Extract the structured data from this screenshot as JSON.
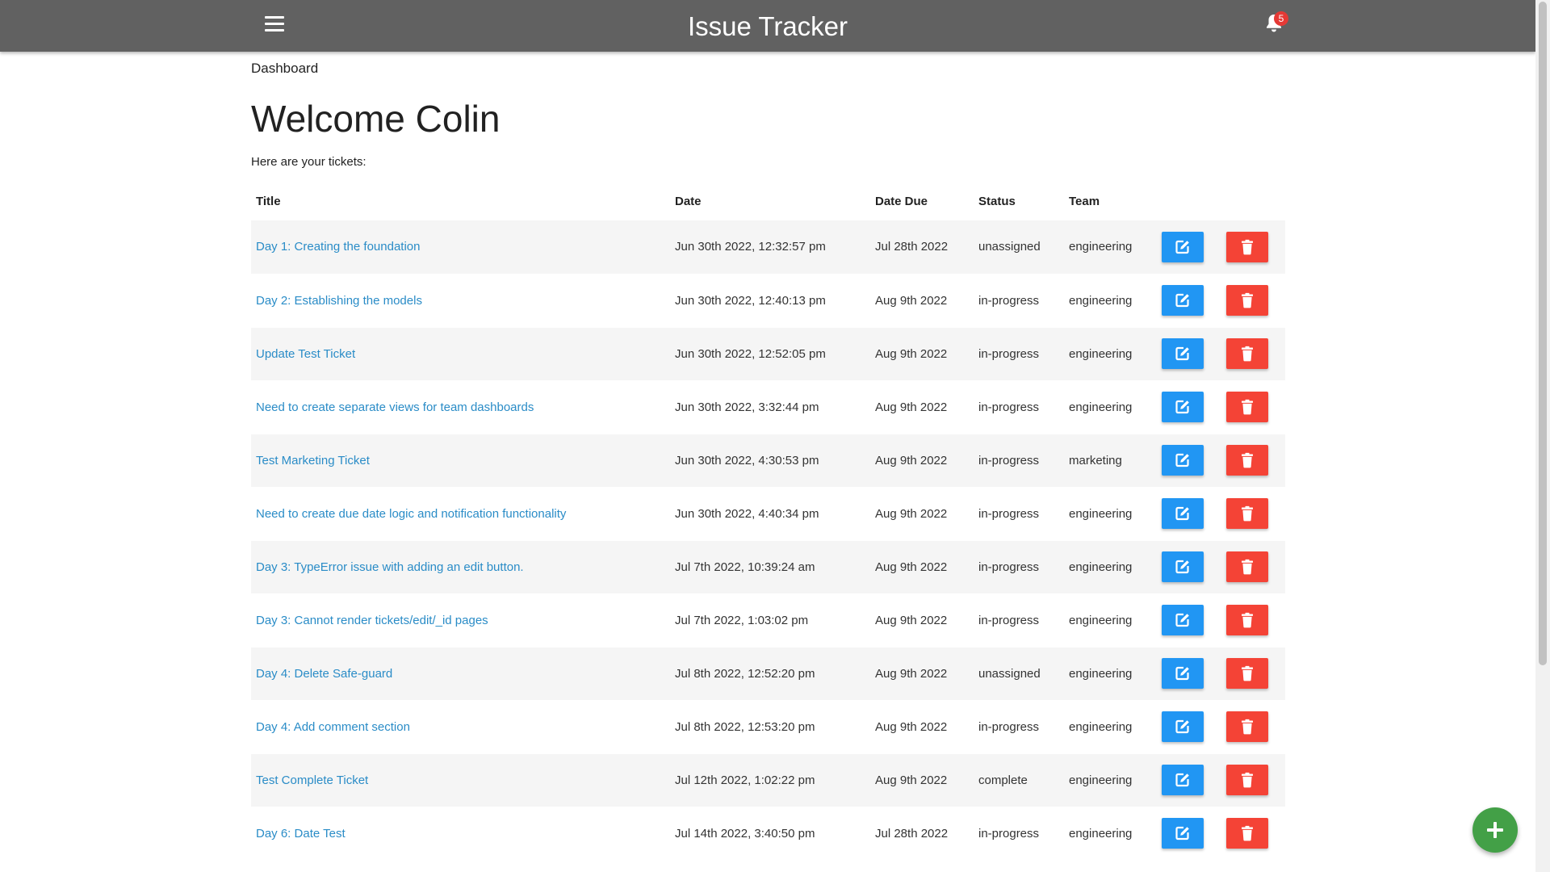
{
  "header": {
    "title": "Issue Tracker",
    "notification_count": "5",
    "menu_icon": "hamburger-menu-icon",
    "bell_icon": "bell-icon"
  },
  "breadcrumb": "Dashboard",
  "welcome": "Welcome Colin",
  "subtitle": "Here are your tickets:",
  "table": {
    "columns": [
      "Title",
      "Date",
      "Date Due",
      "Status",
      "Team"
    ],
    "rows": [
      {
        "title": "Day 1: Creating the foundation",
        "date": "Jun 30th 2022, 12:32:57 pm",
        "due": "Jul 28th 2022",
        "status": "unassigned",
        "team": "engineering"
      },
      {
        "title": "Day 2: Establishing the models",
        "date": "Jun 30th 2022, 12:40:13 pm",
        "due": "Aug 9th 2022",
        "status": "in-progress",
        "team": "engineering"
      },
      {
        "title": "Update Test Ticket",
        "date": "Jun 30th 2022, 12:52:05 pm",
        "due": "Aug 9th 2022",
        "status": "in-progress",
        "team": "engineering"
      },
      {
        "title": "Need to create separate views for team dashboards",
        "date": "Jun 30th 2022, 3:32:44 pm",
        "due": "Aug 9th 2022",
        "status": "in-progress",
        "team": "engineering"
      },
      {
        "title": "Test Marketing Ticket",
        "date": "Jun 30th 2022, 4:30:53 pm",
        "due": "Aug 9th 2022",
        "status": "in-progress",
        "team": "marketing"
      },
      {
        "title": "Need to create due date logic and notification functionality",
        "date": "Jun 30th 2022, 4:40:34 pm",
        "due": "Aug 9th 2022",
        "status": "in-progress",
        "team": "engineering"
      },
      {
        "title": "Day 3: TypeError issue with adding an edit button.",
        "date": "Jul 7th 2022, 10:39:24 am",
        "due": "Aug 9th 2022",
        "status": "in-progress",
        "team": "engineering"
      },
      {
        "title": "Day 3: Cannot render tickets/edit/_id pages",
        "date": "Jul 7th 2022, 1:03:02 pm",
        "due": "Aug 9th 2022",
        "status": "in-progress",
        "team": "engineering"
      },
      {
        "title": "Day 4: Delete Safe-guard",
        "date": "Jul 8th 2022, 12:52:20 pm",
        "due": "Aug 9th 2022",
        "status": "unassigned",
        "team": "engineering"
      },
      {
        "title": "Day 4: Add comment section",
        "date": "Jul 8th 2022, 12:53:20 pm",
        "due": "Aug 9th 2022",
        "status": "in-progress",
        "team": "engineering"
      },
      {
        "title": "Test Complete Ticket",
        "date": "Jul 12th 2022, 1:02:22 pm",
        "due": "Aug 9th 2022",
        "status": "complete",
        "team": "engineering"
      },
      {
        "title": "Day 6: Date Test",
        "date": "Jul 14th 2022, 3:40:50 pm",
        "due": "Jul 28th 2022",
        "status": "in-progress",
        "team": "engineering"
      }
    ]
  },
  "icons": {
    "edit": "edit-icon",
    "delete": "trash-icon",
    "add": "plus-icon"
  },
  "colors": {
    "navbar": "#616161",
    "link": "#2a8cc7",
    "edit_button": "#2196f3",
    "delete_button": "#f44336",
    "fab": "#43a047",
    "badge": "#e53935"
  }
}
